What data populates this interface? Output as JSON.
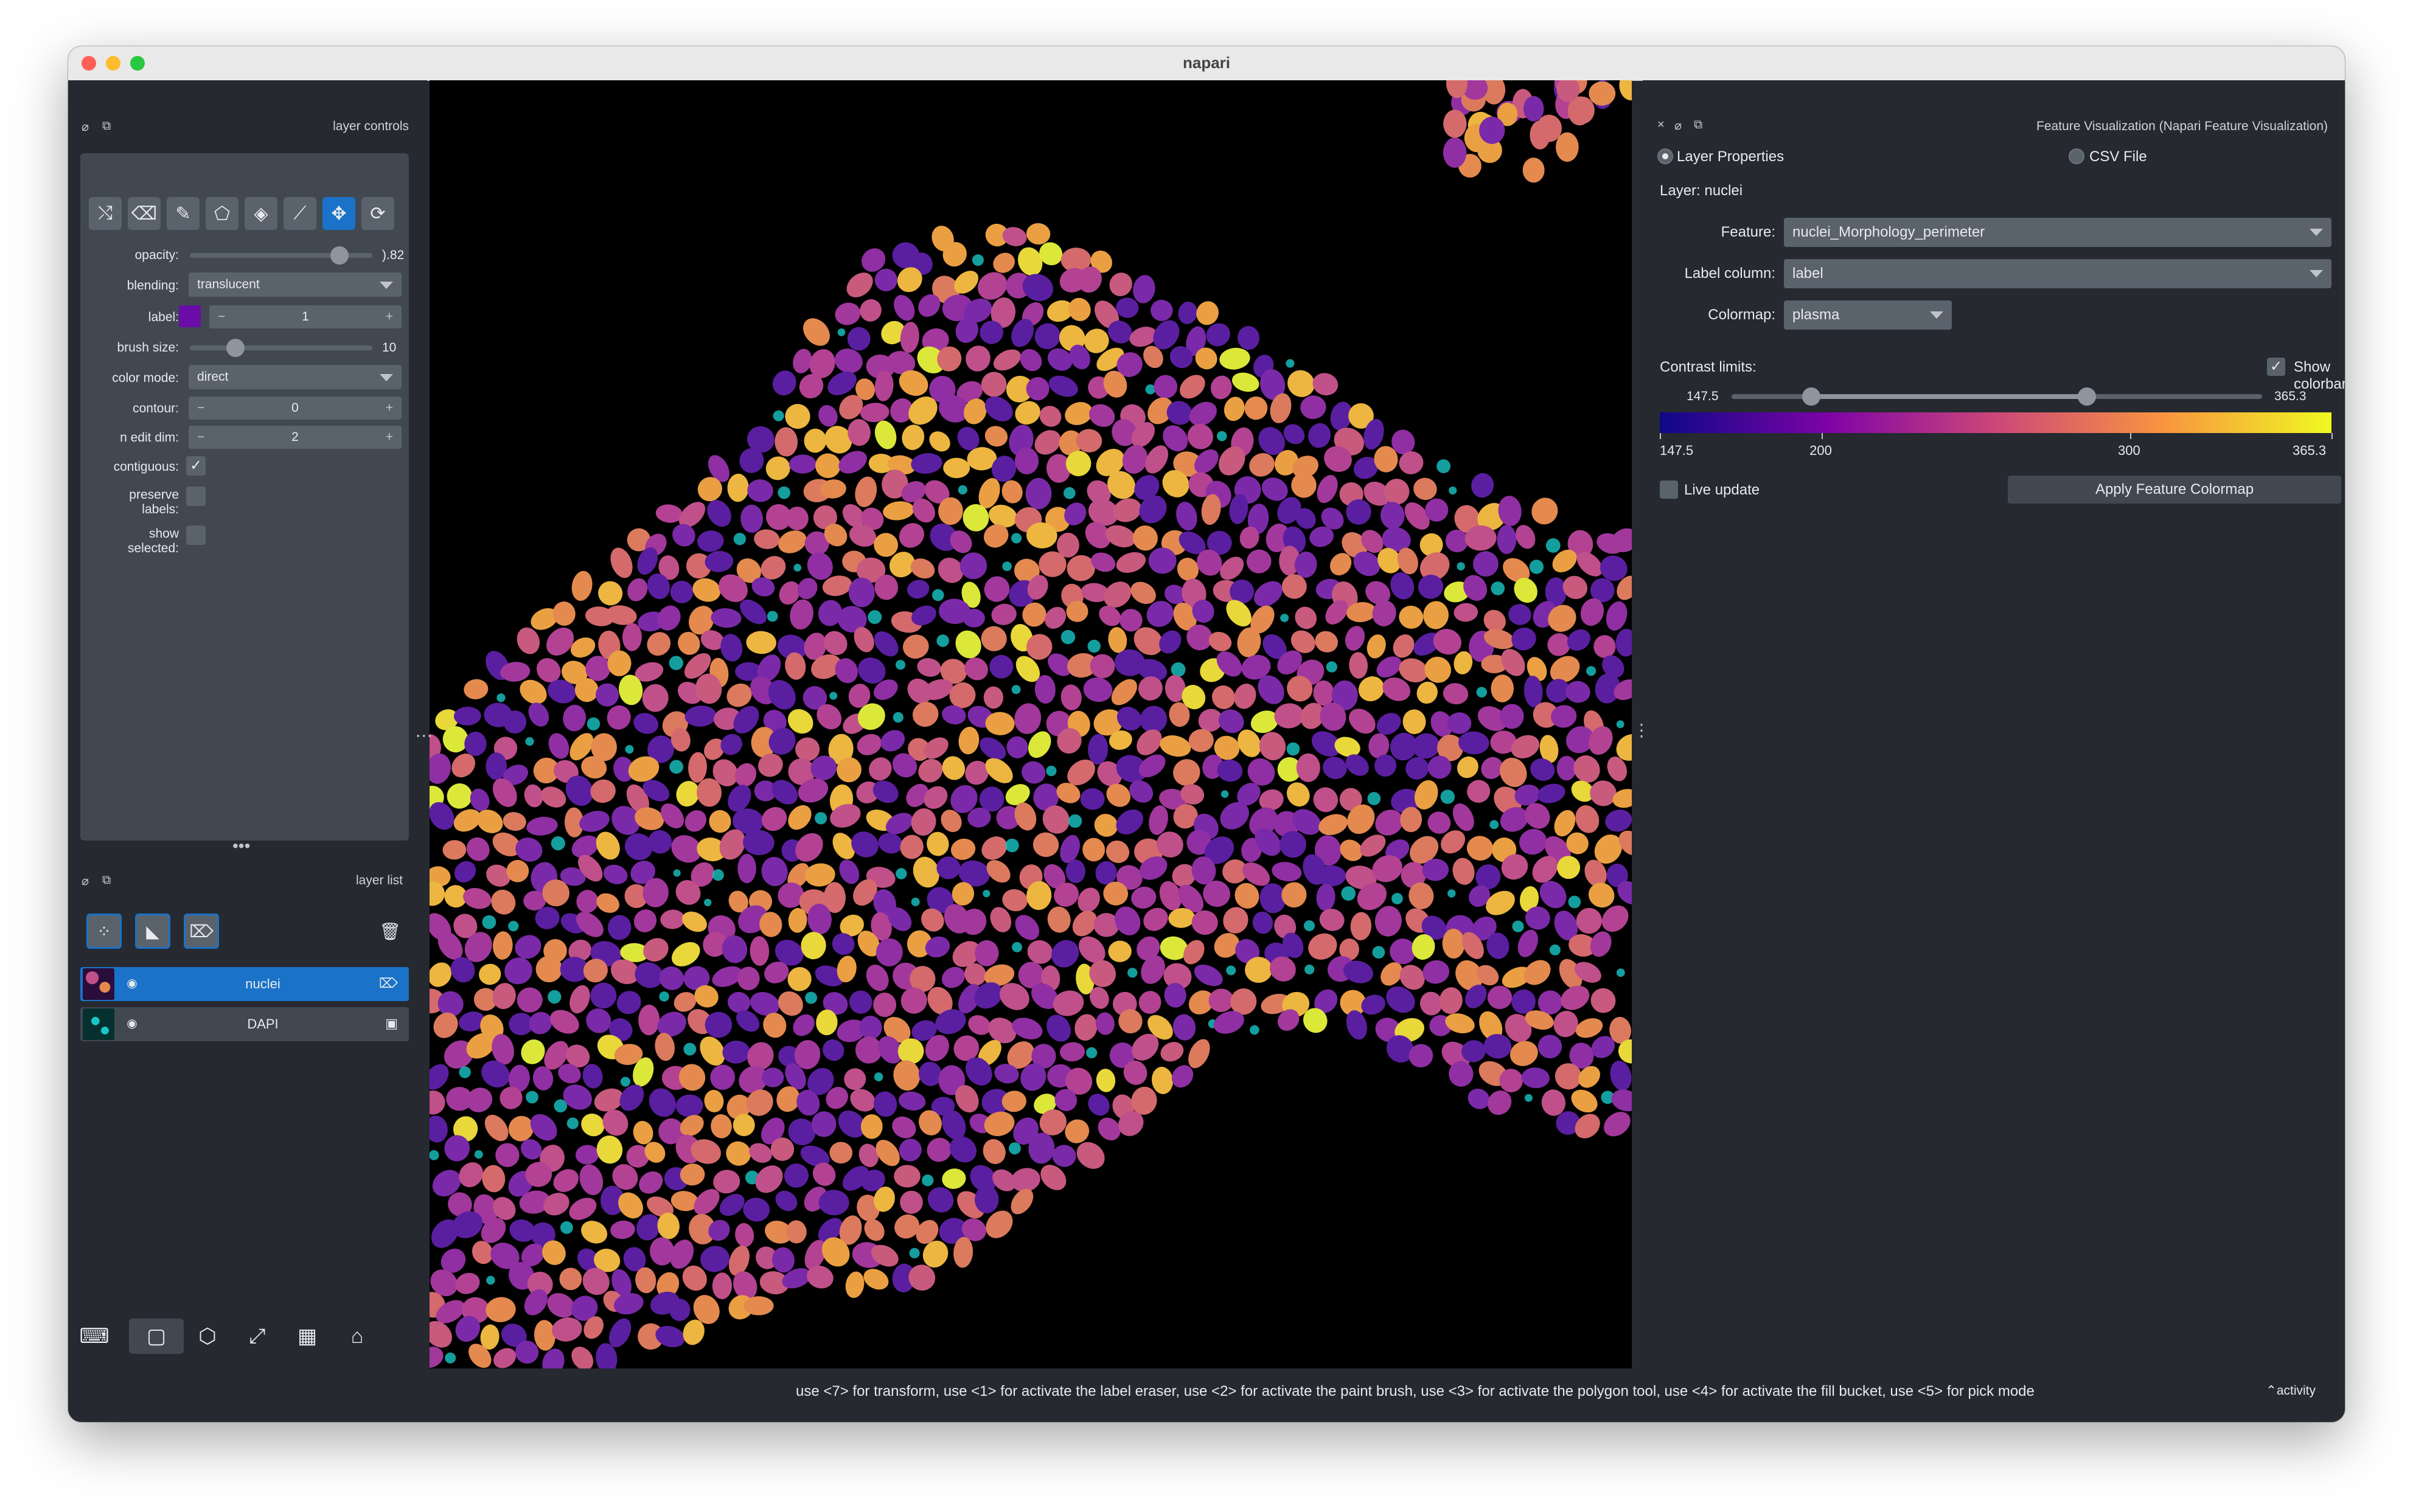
{
  "window": {
    "title": "napari",
    "traffic_lights": [
      "#ff5f57",
      "#febc2e",
      "#28c840"
    ]
  },
  "left_dock": {
    "controls_title": "layer controls",
    "list_title": "layer list",
    "tools": [
      "shuffle-icon",
      "eraser-icon",
      "paint-brush-icon",
      "polygon-icon",
      "fill-bucket-icon",
      "color-picker-icon",
      "pan-zoom-icon",
      "transform-icon"
    ],
    "active_tool_index": 6,
    "controls": {
      "opacity_label": "opacity:",
      "opacity_value": ").82",
      "opacity_fraction": 0.82,
      "blending_label": "blending:",
      "blending_value": "translucent",
      "label_label": "label:",
      "label_color": "#6a0da8",
      "label_value": "1",
      "brush_size_label": "brush size:",
      "brush_size_value": "10",
      "brush_size_fraction": 0.25,
      "color_mode_label": "color mode:",
      "color_mode_value": "direct",
      "contour_label": "contour:",
      "contour_value": "0",
      "n_edit_dim_label": "n edit dim:",
      "n_edit_dim_value": "2",
      "contiguous_label": "contiguous:",
      "contiguous_checked": true,
      "preserve_labels_label": [
        "preserve",
        "labels:"
      ],
      "show_selected_label": [
        "show",
        "selected:"
      ]
    },
    "layer_buttons": [
      "new-points-layer-icon",
      "new-shapes-layer-icon",
      "new-labels-layer-icon"
    ],
    "layers": [
      {
        "name": "nuclei",
        "type_icon": "labels-icon",
        "selected": true
      },
      {
        "name": "DAPI",
        "type_icon": "image-icon",
        "selected": false
      }
    ],
    "bottom_buttons": [
      "console-icon",
      "ndisplay-toggle-icon",
      "roll-dims-icon",
      "transpose-dims-icon",
      "grid-icon",
      "home-icon"
    ]
  },
  "feature_panel": {
    "title": "Feature Visualization (Napari Feature Visualization)",
    "source_options": [
      "Layer Properties",
      "CSV File"
    ],
    "selected_source": "Layer Properties",
    "layer_text": "Layer: nuclei",
    "feature_label": "Feature:",
    "feature_value": "nuclei_Morphology_perimeter",
    "label_column_label": "Label column:",
    "label_column_value": "label",
    "colormap_label": "Colormap:",
    "colormap_value": "plasma",
    "contrast_label": "Contrast limits:",
    "show_colorbar_label": "Show colorbar",
    "show_colorbar_checked": true,
    "contrast_min": "147.5",
    "contrast_max": "365.3",
    "contrast_low_value": 147.5,
    "contrast_high_value": 365.3,
    "colorbar_ticks": [
      "147.5",
      "200",
      "300",
      "365.3"
    ],
    "colorbar_colors": [
      "#0d0887",
      "#7e03a8",
      "#cc4778",
      "#f89540",
      "#f0f921"
    ],
    "live_update_label": "Live update",
    "live_update_checked": false,
    "apply_button": "Apply Feature Colormap"
  },
  "status": {
    "text": "use <7> for transform, use <1> for activate the label eraser, use <2> for activate the paint brush, use <3> for activate the polygon tool, use <4> for activate the fill bucket, use <5> for pick mode",
    "activity": "activity"
  },
  "viewer": {
    "palette": [
      "#5a1fa0",
      "#7a2aa8",
      "#8f2fa3",
      "#a2389c",
      "#b34293",
      "#c0508a",
      "#c85a7e",
      "#d46a6c",
      "#dc7a5e",
      "#e48a4e",
      "#eaa042",
      "#ecb640",
      "#e8d83a",
      "#dbe83a"
    ],
    "cyan": "#19c6c6"
  }
}
